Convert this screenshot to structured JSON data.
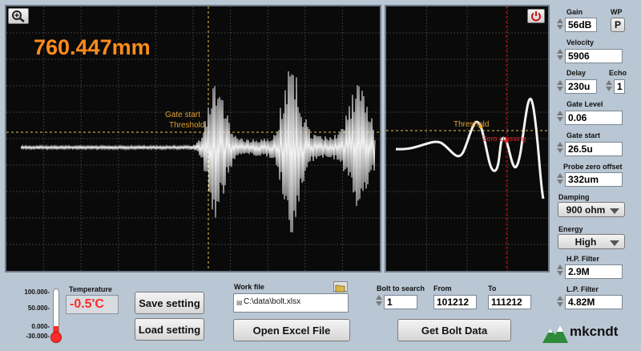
{
  "display": {
    "distance_readout": "760.447mm",
    "gate_start_label": "Gate start",
    "threshold_label_main": "Threshold",
    "threshold_label_zoom": "Threshold",
    "zero_crossing_label": "Zero crossing"
  },
  "settings": {
    "gain_label": "Gain",
    "gain_value": "56dB",
    "wp_label": "WP",
    "wp_value": "P",
    "velocity_label": "Velocity",
    "velocity_value": "5906",
    "delay_label": "Delay",
    "delay_value": "230u",
    "echo_label": "Echo",
    "echo_value": "1",
    "gate_level_label": "Gate Level",
    "gate_level_value": "0.06",
    "gate_start_label": "Gate start",
    "gate_start_value": "26.5u",
    "probe_zero_label": "Probe zero offset",
    "probe_zero_value": "332um",
    "damping_label": "Damping",
    "damping_value": "900 ohm",
    "energy_label": "Energy",
    "energy_value": "High",
    "hp_filter_label": "H.P. Filter",
    "hp_filter_value": "2.9M",
    "lp_filter_label": "L.P. Filter",
    "lp_filter_value": "4.82M"
  },
  "thermometer": {
    "ticks": [
      "100.000-",
      "50.000-",
      "0.000-",
      "-30.000-"
    ],
    "temperature_label": "Temperature",
    "temperature_value": "-0.5'C",
    "level": 0.22
  },
  "buttons": {
    "save": "Save setting",
    "load": "Load setting",
    "open_excel": "Open Excel File",
    "get_bolt": "Get Bolt Data"
  },
  "work_file": {
    "label": "Work file",
    "path": "C:\\data\\bolt.xlsx"
  },
  "bolt": {
    "search_label": "Bolt to search",
    "search_value": "1",
    "from_label": "From",
    "from_value": "101212",
    "to_label": "To",
    "to_value": "111212"
  },
  "logo": {
    "text": "mkcndt"
  },
  "colors": {
    "accent_orange": "#ff8c1a",
    "temp_red": "#ff2a2a",
    "panel_bg": "#0a0a0a",
    "gate_yellow": "#e8c84a",
    "marker_red": "#d01010"
  }
}
